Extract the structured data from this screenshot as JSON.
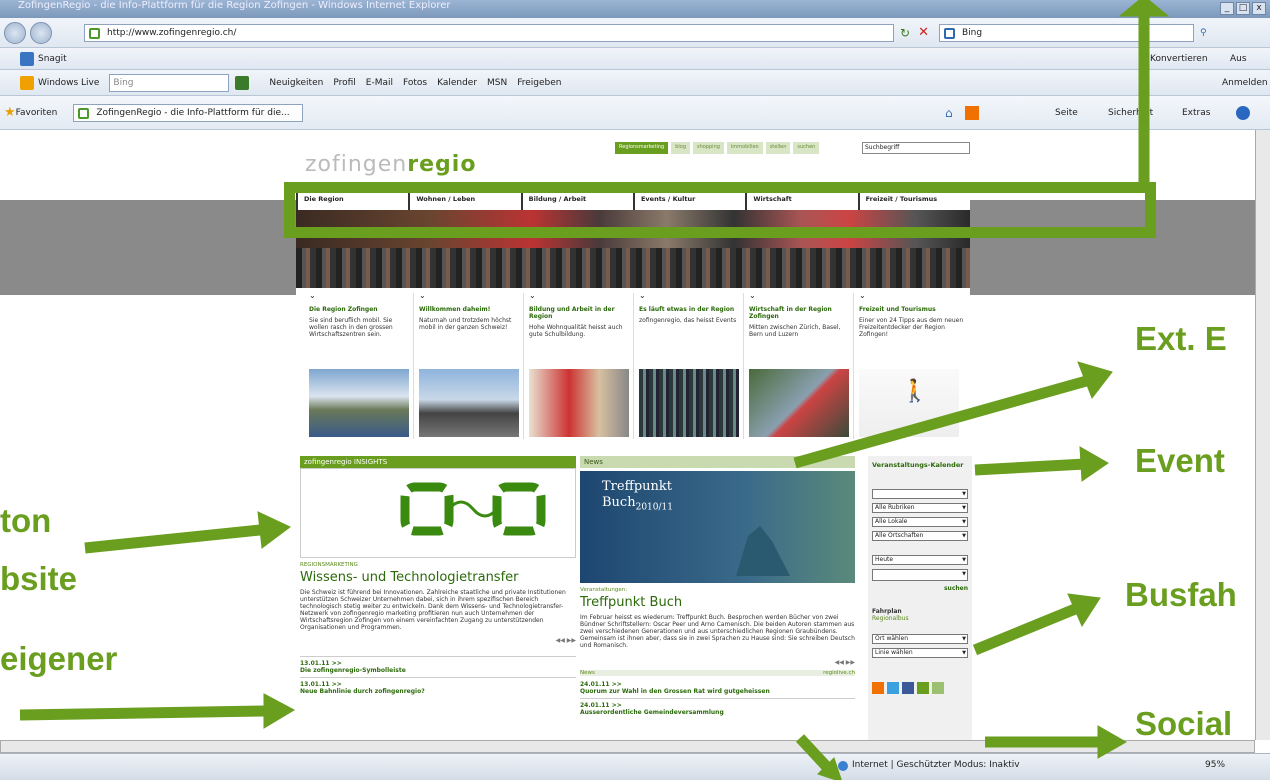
{
  "browser": {
    "window_title": "ZofingenRegio - die Info-Plattform für die Region Zofingen - Windows Internet Explorer",
    "url": "http://www.zofingenregio.ch/",
    "search_placeholder": "Bing",
    "menu": [
      "Snagit"
    ],
    "menu_right": [
      "Konvertieren",
      "Aus"
    ],
    "wl_label": "Windows Live",
    "wl_search": "Bing",
    "wl_links": [
      "Neuigkeiten",
      "Profil",
      "E-Mail",
      "Fotos",
      "Kalender",
      "MSN",
      "Freigeben"
    ],
    "wl_signin": "Anmelden",
    "favorites_label": "Favoriten",
    "tab_title": "ZofingenRegio - die Info-Plattform für die...",
    "cmd": [
      "Seite",
      "Sicherheit",
      "Extras"
    ],
    "status_zone": "Internet | Geschützter Modus: Inaktiv",
    "zoom": "95%"
  },
  "site": {
    "logo_light": "zofingen",
    "logo_bold": "regio",
    "top_links": [
      "Regionsmarketing",
      "blog",
      "shopping",
      "immobilien",
      "stellen",
      "suchen"
    ],
    "search_value": "Suchbegriff",
    "nav": [
      "Die Region",
      "Wohnen / Leben",
      "Bildung / Arbeit",
      "Events / Kultur",
      "Wirtschaft",
      "Freizeit / Tourismus"
    ],
    "teasers": [
      {
        "title": "Die Region Zofingen",
        "text": "Sie sind beruflich mobil. Sie wollen rasch in den grossen Wirtschaftszentren sein."
      },
      {
        "title": "Willkommen daheim!",
        "text": "Naturnah und trotzdem höchst mobil in der ganzen Schweiz!"
      },
      {
        "title": "Bildung und Arbeit in der Region",
        "text": "Hohe Wohnqualität heisst auch gute Schulbildung."
      },
      {
        "title": "Es läuft etwas in der Region",
        "text": "zofingenregio, das heisst Events"
      },
      {
        "title": "Wirtschaft in der Region Zofingen",
        "text": "Mitten zwischen Zürich, Basel, Bern und Luzern"
      },
      {
        "title": "Freizeit und Tourismus",
        "text": "Einer von 24 Tipps aus dem neuen Freizeitentdecker der Region Zofingen!"
      }
    ],
    "insights": {
      "head": "zofingenregio INSIGHTS",
      "kicker": "REGIONSMARKETING",
      "title": "Wissens- und Technologietransfer",
      "text": "Die Schweiz ist führend bei Innovationen. Zahlreiche staatliche und private Institutionen unterstützen Schweizer Unternehmen dabei, sich in ihrem spezifischen Bereich technologisch stetig weiter zu entwickeln. Dank dem Wissens- und Technologietransfer-Netzwerk von zofingenregio marketing profitieren nun auch Unternehmen der Wirtschaftsregion Zofingen von einem vereinfachten Zugang zu unterstützenden Organisationen und Programmen.",
      "pager": "◀◀  ▶▶",
      "items": [
        {
          "date": "13.01.11 >>",
          "title": "Die zofingenregio-Symbolleiste"
        },
        {
          "date": "13.01.11 >>",
          "title": "Neue Bahnlinie durch zofingenregio?"
        }
      ]
    },
    "news": {
      "head": "News",
      "banner_line1": "Treffpunkt",
      "banner_line2": "Buch",
      "banner_year": "2010/11",
      "kicker": "Veranstaltungen:",
      "title": "Treffpunkt Buch",
      "text": "Im Februar heisst es wiederum: Treffpunkt Buch. Besprochen werden Bücher von zwei Bündner Schriftstellern: Oscar Peer und Arno Camenisch. Die beiden Autoren stammen aus zwei verschiedenen Generationen und aus unterschiedlichen Regionen Graubündens. Gemeinsam ist ihnen aber, dass sie in zwei Sprachen zu Hause sind: Sie schreiben Deutsch und Romanisch.",
      "pager": "◀◀  ▶▶",
      "sub_left": "News",
      "sub_right": "regiolive.ch",
      "items": [
        {
          "date": "24.01.11 >>",
          "title": "Quorum zur Wahl in den Grossen Rat wird gutgeheissen"
        },
        {
          "date": "24.01.11 >>",
          "title": "Ausserordentliche Gemeindeversammlung"
        }
      ]
    },
    "calendar": {
      "head": "Veranstaltungs-Kalender",
      "selects": [
        "Alle Rubriken",
        "Alle Lokale",
        "Alle Ortschaften"
      ],
      "date_select": "Heute",
      "search": "suchen",
      "fahrplan": "Fahrplan",
      "regionalbus": "Regionalbus",
      "bus_selects": [
        "Ort wählen",
        "Linie wählen"
      ]
    }
  },
  "annotations": [
    "Ext. E",
    "Event",
    "ton",
    "bsite",
    "Busfah",
    "eigener",
    "Social"
  ]
}
